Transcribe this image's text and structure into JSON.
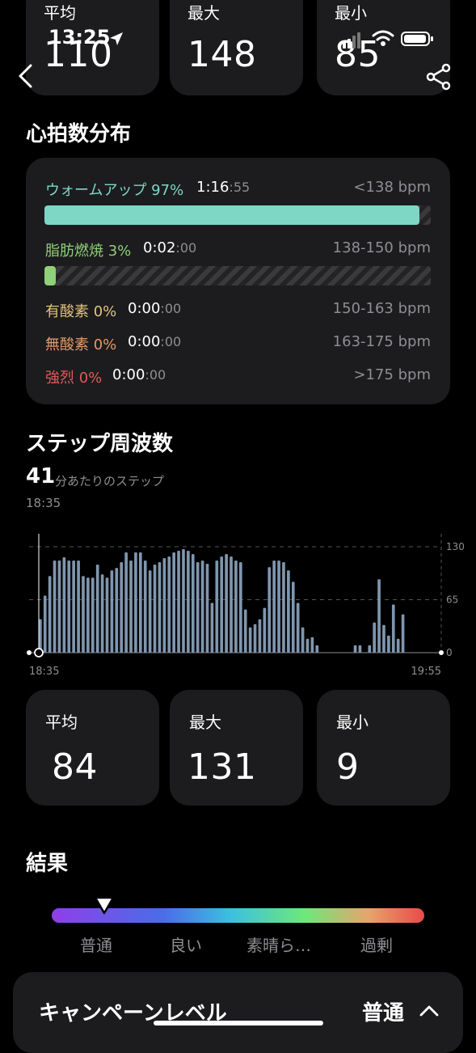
{
  "status_bar": {
    "time": "13:25"
  },
  "hr_stats": {
    "avg": {
      "label": "平均",
      "value": "110"
    },
    "max": {
      "label": "最大",
      "value": "148"
    },
    "min": {
      "label": "最小",
      "value": "85"
    }
  },
  "hr_distribution": {
    "title": "心拍数分布",
    "zones": [
      {
        "name": "ウォームアップ 97%",
        "time_main": "1:16",
        "time_sec": ":55",
        "range": "<138 bpm",
        "color": "#7ed6c4",
        "fill": 0.97
      },
      {
        "name": "脂肪燃焼 3%",
        "time_main": "0:02",
        "time_sec": ":00",
        "range": "138-150 bpm",
        "color": "#8fd07a",
        "fill": 0.03
      },
      {
        "name": "有酸素 0%",
        "time_main": "0:00",
        "time_sec": ":00",
        "range": "150-163 bpm",
        "color": "#e3c27a"
      },
      {
        "name": "無酸素 0%",
        "time_main": "0:00",
        "time_sec": ":00",
        "range": "163-175 bpm",
        "color": "#e39a6a"
      },
      {
        "name": "強烈 0%",
        "time_main": "0:00",
        "time_sec": ":00",
        "range": ">175 bpm",
        "color": "#e05a5a"
      }
    ]
  },
  "step_frequency": {
    "title": "ステップ周波数",
    "current_value": "41",
    "current_unit": "分あたりのステップ",
    "current_time": "18:35",
    "x_start": "18:35",
    "x_end": "19:55",
    "y_ticks": [
      "130",
      "65",
      "0"
    ]
  },
  "chart_data": {
    "type": "bar",
    "xlabel": "",
    "ylabel": "",
    "x_range": [
      "18:35",
      "19:55"
    ],
    "ylim": [
      0,
      130
    ],
    "grid": true,
    "values": [
      41,
      70,
      94,
      113,
      113,
      117,
      113,
      113,
      113,
      94,
      92,
      92,
      108,
      96,
      92,
      101,
      104,
      111,
      123,
      113,
      123,
      123,
      113,
      101,
      108,
      111,
      116,
      118,
      123,
      125,
      127,
      125,
      121,
      111,
      113,
      109,
      61,
      113,
      118,
      121,
      118,
      113,
      111,
      53,
      31,
      35,
      41,
      55,
      105,
      113,
      113,
      111,
      101,
      87,
      61,
      31,
      17,
      19,
      9,
      0,
      0,
      0,
      0,
      0,
      0,
      0,
      9,
      9,
      0,
      9,
      37,
      90,
      34,
      21,
      59,
      17,
      47,
      0,
      0,
      0,
      0,
      0,
      0,
      0
    ],
    "series_color": "#7f96ae",
    "y_ticks": [
      0,
      65,
      130
    ]
  },
  "step_stats": {
    "avg": {
      "label": "平均",
      "value": "84"
    },
    "max": {
      "label": "最大",
      "value": "131"
    },
    "min": {
      "label": "最小",
      "value": "9"
    }
  },
  "result": {
    "title": "結果",
    "levels": [
      "普通",
      "良い",
      "素晴ら…",
      "過剰"
    ],
    "marker_position": 0.14
  },
  "campaign": {
    "label": "キャンペーンレベル",
    "value": "普通"
  }
}
